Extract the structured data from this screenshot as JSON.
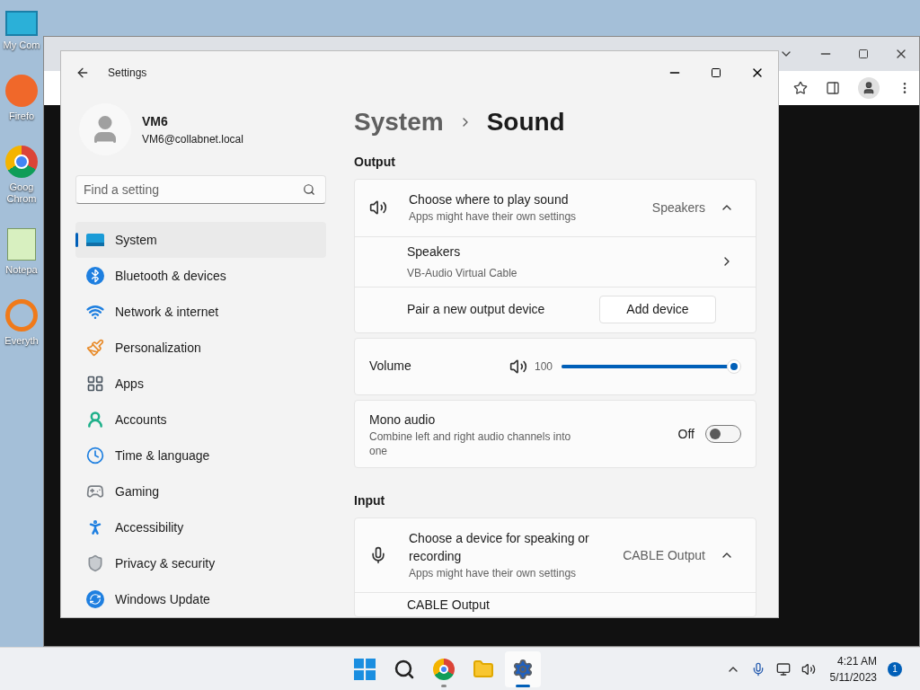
{
  "desktop_icons": [
    {
      "label": "My Com"
    },
    {
      "label": "Firefo"
    },
    {
      "label": "Goog Chrom"
    },
    {
      "label": "Notepa"
    },
    {
      "label": "Everyth"
    }
  ],
  "settings": {
    "title": "Settings",
    "user": {
      "name": "VM6",
      "email": "VM6@collabnet.local"
    },
    "search": {
      "placeholder": "Find a setting"
    },
    "nav": [
      {
        "label": "System",
        "selected": true
      },
      {
        "label": "Bluetooth & devices",
        "selected": false
      },
      {
        "label": "Network & internet",
        "selected": false
      },
      {
        "label": "Personalization",
        "selected": false
      },
      {
        "label": "Apps",
        "selected": false
      },
      {
        "label": "Accounts",
        "selected": false
      },
      {
        "label": "Time & language",
        "selected": false
      },
      {
        "label": "Gaming",
        "selected": false
      },
      {
        "label": "Accessibility",
        "selected": false
      },
      {
        "label": "Privacy & security",
        "selected": false
      },
      {
        "label": "Windows Update",
        "selected": false
      }
    ],
    "breadcrumb": {
      "parent": "System",
      "current": "Sound"
    },
    "output": {
      "heading": "Output",
      "chooser": {
        "title": "Choose where to play sound",
        "subtitle": "Apps might have their own settings",
        "value": "Speakers",
        "expanded": true
      },
      "devices": [
        {
          "name": "Speakers",
          "detail": "VB-Audio Virtual Cable"
        }
      ],
      "pair": {
        "label": "Pair a new output device",
        "button": "Add device"
      },
      "volume": {
        "label": "Volume",
        "reading": "100",
        "level": 1.0
      },
      "mono": {
        "title": "Mono audio",
        "description": "Combine left and right audio channels into one",
        "state_label": "Off",
        "on": false
      }
    },
    "input": {
      "heading": "Input",
      "chooser": {
        "title": "Choose a device for speaking or recording",
        "subtitle": "Apps might have their own settings",
        "value": "CABLE Output",
        "expanded": true
      },
      "devices": [
        {
          "name": "CABLE Output"
        }
      ]
    }
  },
  "taskbar": {
    "apps": [
      {
        "kind": "start",
        "active": false,
        "running": false
      },
      {
        "kind": "search",
        "active": false,
        "running": false
      },
      {
        "kind": "chrome",
        "active": false,
        "running": true
      },
      {
        "kind": "files",
        "active": false,
        "running": false
      },
      {
        "kind": "settings",
        "active": true,
        "running": true
      }
    ],
    "time": "4:21 AM",
    "date": "5/11/2023",
    "notifications": "1"
  }
}
